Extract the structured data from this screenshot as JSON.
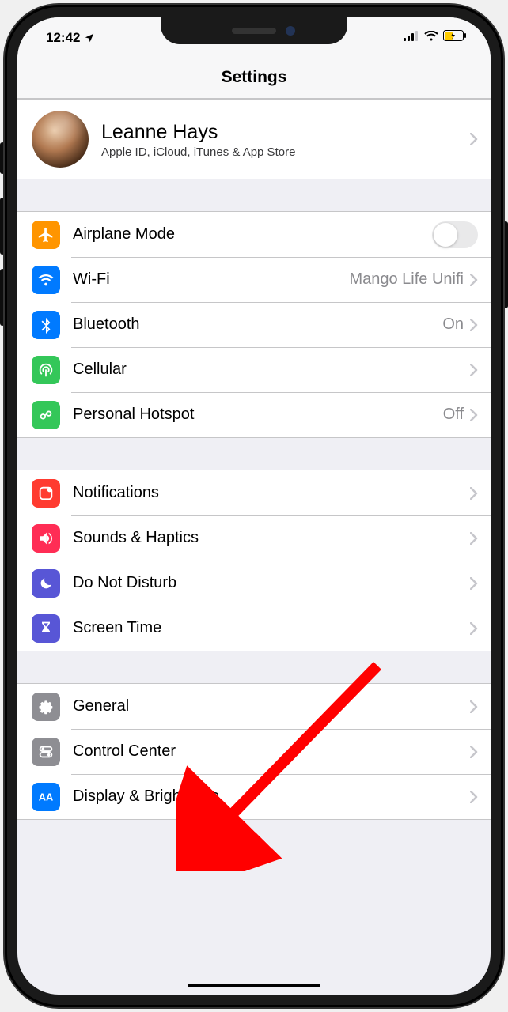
{
  "status": {
    "time": "12:42",
    "location_icon": "location-arrow"
  },
  "header": {
    "title": "Settings"
  },
  "profile": {
    "name": "Leanne Hays",
    "subtitle": "Apple ID, iCloud, iTunes & App Store"
  },
  "groups": [
    {
      "rows": [
        {
          "icon": "airplane",
          "color": "#ff9500",
          "label": "Airplane Mode",
          "control": "toggle",
          "on": false
        },
        {
          "icon": "wifi",
          "color": "#007aff",
          "label": "Wi-Fi",
          "value": "Mango Life Unifi",
          "control": "disclosure"
        },
        {
          "icon": "bluetooth",
          "color": "#007aff",
          "label": "Bluetooth",
          "value": "On",
          "control": "disclosure"
        },
        {
          "icon": "cellular",
          "color": "#34c759",
          "label": "Cellular",
          "control": "disclosure"
        },
        {
          "icon": "hotspot",
          "color": "#34c759",
          "label": "Personal Hotspot",
          "value": "Off",
          "control": "disclosure"
        }
      ]
    },
    {
      "rows": [
        {
          "icon": "notifications",
          "color": "#ff3b30",
          "label": "Notifications",
          "control": "disclosure"
        },
        {
          "icon": "sounds",
          "color": "#ff2d55",
          "label": "Sounds & Haptics",
          "control": "disclosure"
        },
        {
          "icon": "dnd",
          "color": "#5856d6",
          "label": "Do Not Disturb",
          "control": "disclosure"
        },
        {
          "icon": "screentime",
          "color": "#5856d6",
          "label": "Screen Time",
          "control": "disclosure"
        }
      ]
    },
    {
      "rows": [
        {
          "icon": "general",
          "color": "#8e8e93",
          "label": "General",
          "control": "disclosure"
        },
        {
          "icon": "controlcenter",
          "color": "#8e8e93",
          "label": "Control Center",
          "control": "disclosure"
        },
        {
          "icon": "display",
          "color": "#007aff",
          "label": "Display & Brightness",
          "control": "disclosure"
        }
      ]
    }
  ],
  "annotation": {
    "arrow_color": "#ff0000",
    "target": "general-row"
  }
}
